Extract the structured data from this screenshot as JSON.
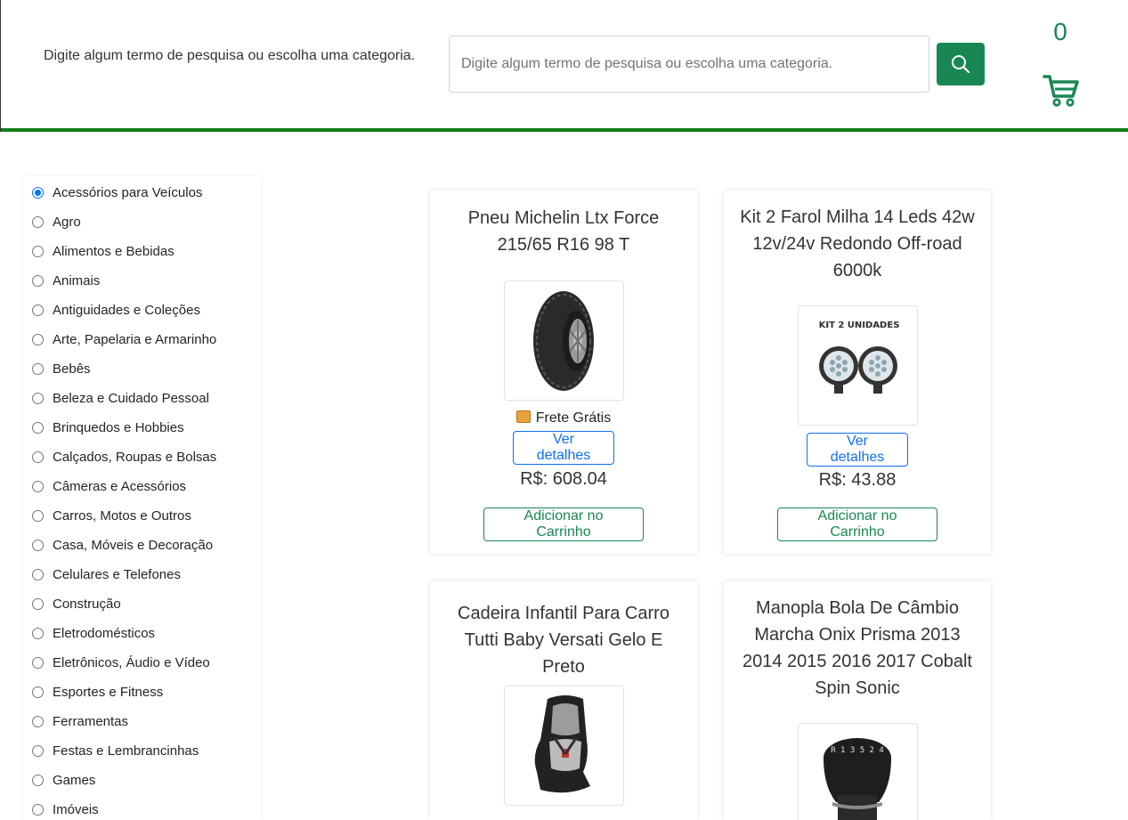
{
  "header": {
    "hint_text": "Digite algum termo de pesquisa ou escolha uma categoria.",
    "search_placeholder": "Digite algum termo de pesquisa ou escolha uma categoria.",
    "search_icon": "search-icon",
    "cart_count": "0",
    "cart_icon": "shopping-cart-icon",
    "accent_color": "#198754",
    "divider_color": "#157c15"
  },
  "sidebar": {
    "selected": "Acessórios para Veículos",
    "categories": [
      "Acessórios para Veículos",
      "Agro",
      "Alimentos e Bebidas",
      "Animais",
      "Antiguidades e Coleções",
      "Arte, Papelaria e Armarinho",
      "Bebês",
      "Beleza e Cuidado Pessoal",
      "Brinquedos e Hobbies",
      "Calçados, Roupas e Bolsas",
      "Câmeras e Acessórios",
      "Carros, Motos e Outros",
      "Casa, Móveis e Decoração",
      "Celulares e Telefones",
      "Construção",
      "Eletrodomésticos",
      "Eletrônicos, Áudio e Vídeo",
      "Esportes e Fitness",
      "Ferramentas",
      "Festas e Lembrancinhas",
      "Games",
      "Imóveis"
    ]
  },
  "products": [
    {
      "title": "Pneu Michelin Ltx Force 215/65 R16 98 T",
      "image": "tire",
      "frete": "Frete Grátis",
      "details_label": "Ver detalhes",
      "price": "R$: 608.04",
      "add_label": "Adicionar no Carrinho"
    },
    {
      "title": "Kit 2 Farol Milha 14 Leds 42w 12v/24v Redondo Off-road 6000k",
      "image": "led-lights",
      "image_text": "KIT 2 UNIDADES",
      "details_label": "Ver detalhes",
      "price": "R$: 43.88",
      "add_label": "Adicionar no Carrinho"
    },
    {
      "title": "Cadeira Infantil Para Carro Tutti Baby Versati Gelo E Preto",
      "image": "child-car-seat"
    },
    {
      "title": "Manopla Bola De Câmbio Marcha Onix Prisma 2013 2014 2015 2016 2017 Cobalt Spin Sonic",
      "image": "gear-knob",
      "image_text": "R 1 3 5 2 4"
    }
  ]
}
